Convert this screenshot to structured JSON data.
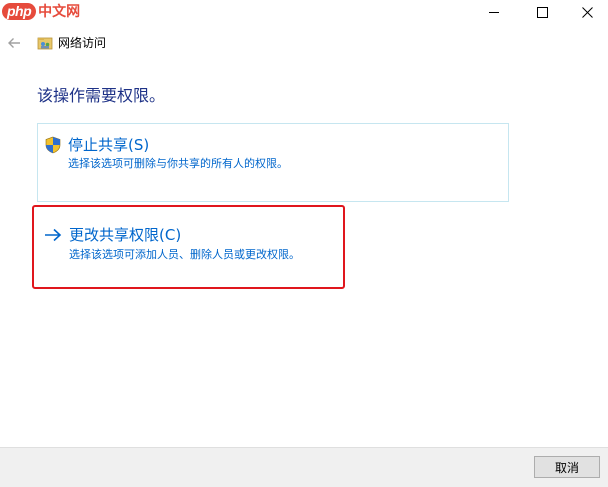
{
  "watermark": {
    "php": "php",
    "text": "中文网"
  },
  "window": {
    "icons": [
      "minimize-icon",
      "maximize-icon",
      "close-icon"
    ]
  },
  "nav": {
    "back_icon": "back-arrow-icon",
    "address_icon": "network-folder-icon",
    "title": "网络访问"
  },
  "main": {
    "heading": "该操作需要权限。",
    "options": [
      {
        "icon": "uac-shield-icon",
        "title": "停止共享(S)",
        "description": "选择该选项可删除与你共享的所有人的权限。"
      },
      {
        "icon": "arrow-right-icon",
        "title": "更改共享权限(C)",
        "description": "选择该选项可添加人员、删除人员或更改权限。"
      }
    ]
  },
  "footer": {
    "cancel_label": "取消"
  },
  "colors": {
    "link": "#0066cc",
    "heading": "#1e3287",
    "highlight": "#e0161d",
    "option_border": "#c6e6f0"
  }
}
